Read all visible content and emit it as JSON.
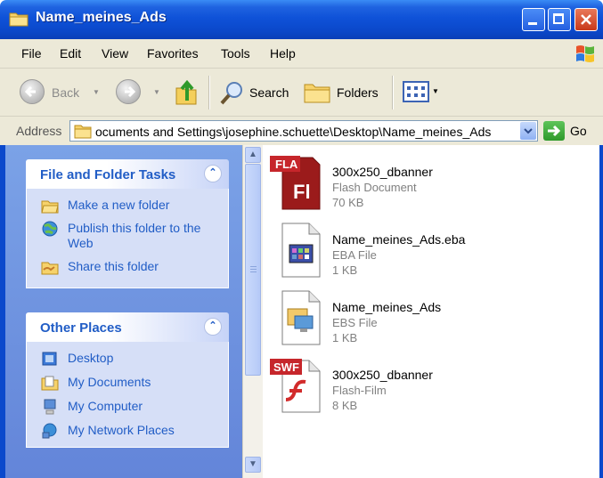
{
  "window": {
    "title": "Name_meines_Ads",
    "icons": [
      "folder-icon",
      "minimize-icon",
      "maximize-icon",
      "close-icon"
    ]
  },
  "menu": {
    "items": [
      "File",
      "Edit",
      "View",
      "Favorites",
      "Tools",
      "Help"
    ]
  },
  "toolbar": {
    "back_label": "Back",
    "search_label": "Search",
    "folders_label": "Folders"
  },
  "address": {
    "label": "Address",
    "path": "ocuments and Settings\\josephine.schuette\\Desktop\\Name_meines_Ads",
    "go_label": "Go"
  },
  "tasks_panel": {
    "title": "File and Folder Tasks",
    "items": [
      {
        "label": "Make a new folder",
        "icon": "new-folder-icon"
      },
      {
        "label": "Publish this folder to the Web",
        "icon": "publish-web-icon"
      },
      {
        "label": "Share this folder",
        "icon": "share-folder-icon"
      }
    ]
  },
  "places_panel": {
    "title": "Other Places",
    "items": [
      {
        "label": "Desktop",
        "icon": "desktop-icon"
      },
      {
        "label": "My Documents",
        "icon": "my-documents-icon"
      },
      {
        "label": "My Computer",
        "icon": "my-computer-icon"
      },
      {
        "label": "My Network Places",
        "icon": "network-places-icon"
      }
    ]
  },
  "files": [
    {
      "name": "300x250_dbanner",
      "type": "Flash Document",
      "size": "70 KB",
      "icon": "fla-file-icon",
      "badge": "FLA",
      "glyph": "Fl"
    },
    {
      "name": "Name_meines_Ads.eba",
      "type": "EBA File",
      "size": "1 KB",
      "icon": "eba-file-icon"
    },
    {
      "name": "Name_meines_Ads",
      "type": "EBS File",
      "size": "1 KB",
      "icon": "ebs-file-icon"
    },
    {
      "name": "300x250_dbanner",
      "type": "Flash-Film",
      "size": "8 KB",
      "icon": "swf-file-icon",
      "badge": "SWF"
    }
  ],
  "colors": {
    "titlebar": "#0b49cc",
    "task_link": "#215dc6",
    "pane_bg": "#6385d9"
  }
}
